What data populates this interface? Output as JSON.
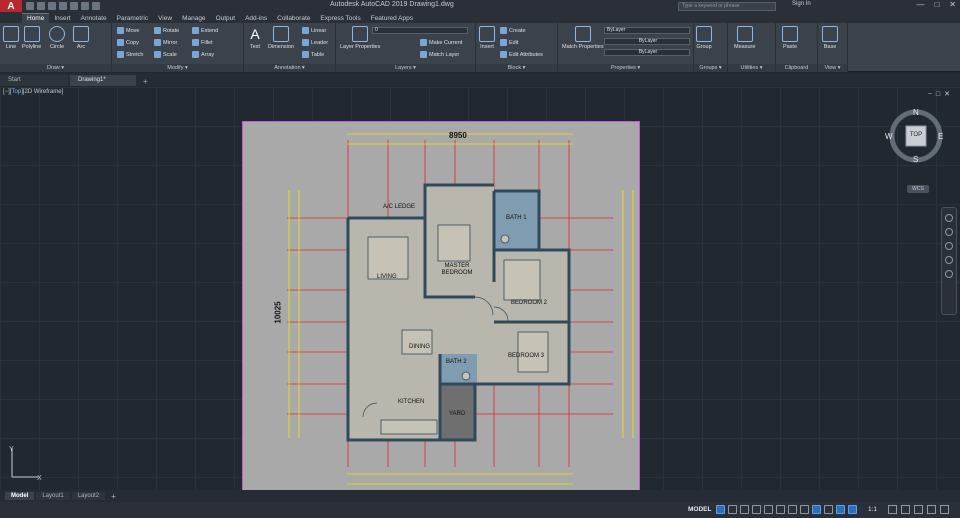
{
  "titlebar": {
    "title": "Autodesk AutoCAD 2019   Drawing1.dwg",
    "search_placeholder": "Type a keyword or phrase",
    "signin": "Sign In",
    "controls": [
      "—",
      "□",
      "✕"
    ]
  },
  "ribbon_tabs": [
    "Home",
    "Insert",
    "Annotate",
    "Parametric",
    "View",
    "Manage",
    "Output",
    "Add-ins",
    "Collaborate",
    "Express Tools",
    "Featured Apps"
  ],
  "panels": {
    "draw": {
      "title": "Draw ▾",
      "buttons": [
        "Line",
        "Polyline",
        "Circle",
        "Arc"
      ]
    },
    "modify": {
      "title": "Modify ▾",
      "rows": [
        [
          "Move",
          "Rotate",
          "Extend"
        ],
        [
          "Copy",
          "Mirror",
          "Fillet"
        ],
        [
          "Stretch",
          "Scale",
          "Array"
        ]
      ]
    },
    "annotation": {
      "title": "Annotation ▾",
      "big": [
        "Text",
        "Dimension"
      ],
      "rows": [
        "Linear",
        "Leader",
        "Table"
      ]
    },
    "layers": {
      "title": "Layers ▾",
      "big": "Layer Properties",
      "current_layer": "0",
      "rows": [
        "Make Current",
        "Match Layer"
      ]
    },
    "block": {
      "title": "Block ▾",
      "big": "Insert",
      "rows": [
        "Create",
        "Edit",
        "Edit Attributes"
      ]
    },
    "properties": {
      "title": "Properties ▾",
      "big": "Match Properties",
      "dropdowns": [
        "ByLayer",
        "ByLayer",
        "ByLayer"
      ]
    },
    "groups": {
      "title": "Groups ▾",
      "big": "Group"
    },
    "utilities": {
      "title": "Utilities ▾",
      "big": "Measure"
    },
    "clipboard": {
      "title": "Clipboard",
      "big": "Paste"
    },
    "view": {
      "title": "View ▾",
      "big": "Base"
    }
  },
  "doc_tabs": [
    "Start",
    "Drawing1*"
  ],
  "viewport": {
    "label_prefix": "[−][",
    "label_view": "Top",
    "label_suffix": "][2D Wireframe]",
    "viewcube": {
      "top": "TOP",
      "n": "N",
      "s": "S",
      "e": "E",
      "w": "W"
    },
    "wcs": "WCS"
  },
  "plan": {
    "dim_top": "8950",
    "dim_left": "10025",
    "rooms": [
      "A/C LEDGE",
      "BATH 1",
      "LIVING",
      "MASTER BEDROOM",
      "BEDROOM 2",
      "DINING",
      "BATH 2",
      "BEDROOM 3",
      "KITCHEN",
      "YARD"
    ]
  },
  "layout_tabs": [
    "Model",
    "Layout1",
    "Layout2"
  ],
  "status": {
    "model": "MODEL",
    "scale": "1:1"
  },
  "colors": {
    "background": "#212830",
    "ribbon": "#3b424c",
    "sheet": "#a9a9a9",
    "grid_line": "#e0262a",
    "wall": "#2f4a5a"
  }
}
